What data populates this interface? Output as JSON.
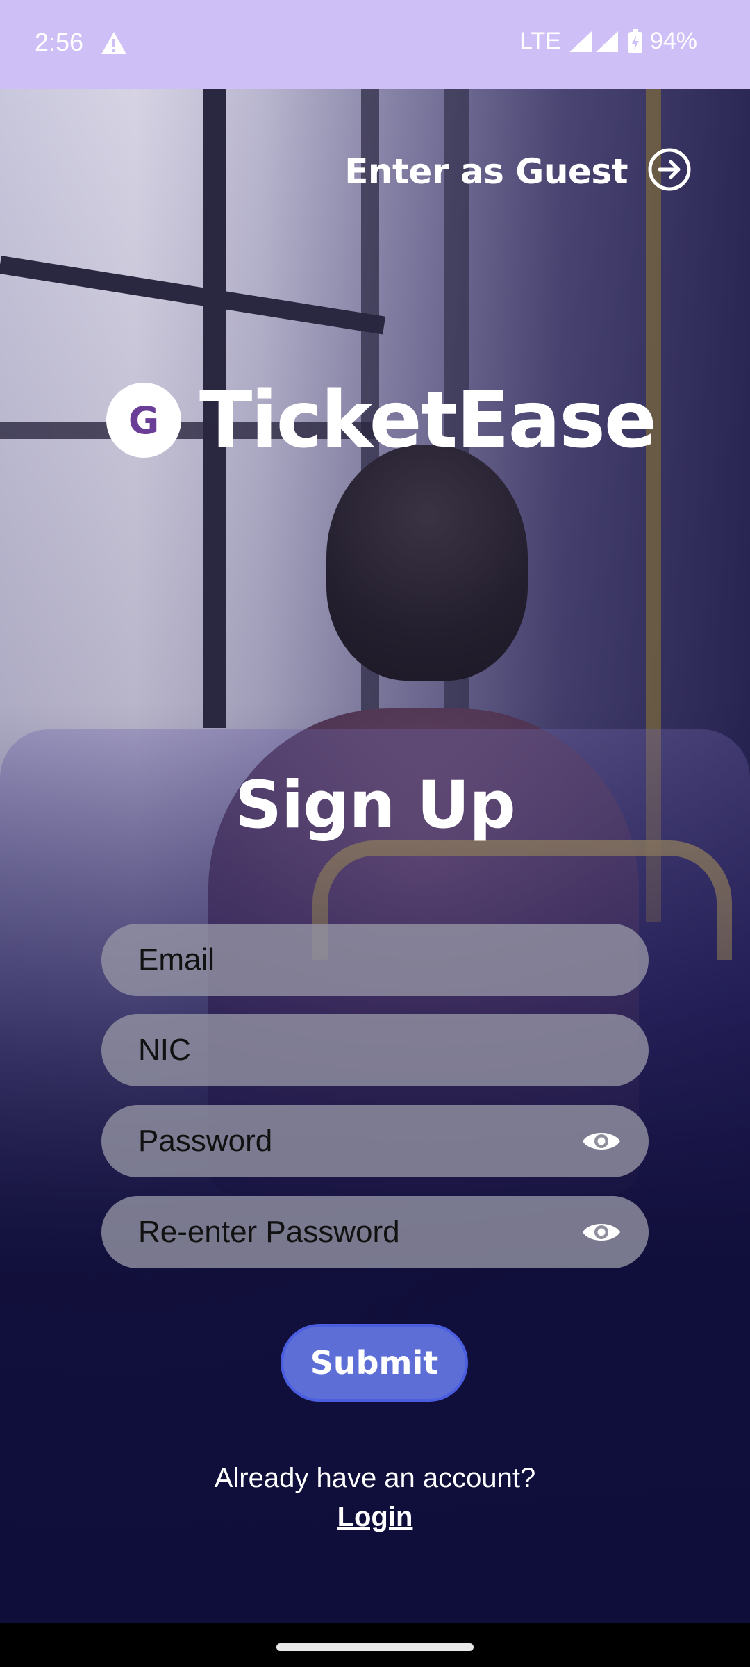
{
  "status_bar": {
    "time": "2:56",
    "network": "LTE",
    "battery": "94%"
  },
  "header": {
    "guest_label": "Enter as Guest"
  },
  "logo": {
    "badge_letter": "G",
    "app_name": "TicketEase"
  },
  "form": {
    "title": "Sign Up",
    "email_placeholder": "Email",
    "nic_placeholder": "NIC",
    "password_placeholder": "Password",
    "reenter_placeholder": "Re-enter Password",
    "submit_label": "Submit"
  },
  "footer": {
    "already_text": "Already have an account?",
    "login_label": "Login"
  },
  "colors": {
    "status_bar": "#cfbff7",
    "submit_button": "#5d6fd6",
    "logo_letter": "#6a3d96",
    "sheet_bottom": "#0f0d3a"
  },
  "icons": [
    "warning-icon",
    "signal-icon",
    "battery-icon",
    "arrow-right-circle-icon",
    "eye-icon"
  ]
}
